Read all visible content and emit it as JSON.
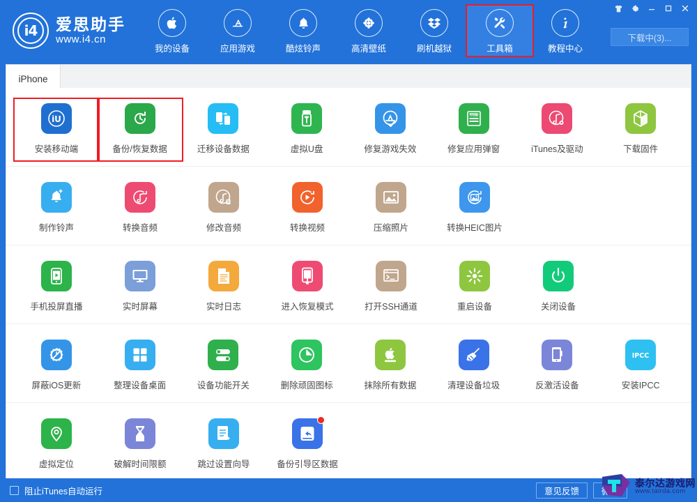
{
  "window": {
    "brand_name": "爱思助手",
    "brand_url": "www.i4.cn",
    "brand_logo_text": "i4",
    "controls": [
      {
        "name": "skin-icon",
        "label": "皮肤"
      },
      {
        "name": "settings-icon",
        "label": "设置"
      },
      {
        "name": "minimize-icon",
        "label": "最小化"
      },
      {
        "name": "maximize-icon",
        "label": "最大化"
      },
      {
        "name": "close-icon",
        "label": "关闭"
      }
    ],
    "download_button": "下载中(3)..."
  },
  "nav": {
    "items": [
      {
        "label": "我的设备",
        "icon": "apple-icon",
        "active": false,
        "highlighted": false
      },
      {
        "label": "应用游戏",
        "icon": "appstore-icon",
        "active": false,
        "highlighted": false
      },
      {
        "label": "酷炫铃声",
        "icon": "bell-icon",
        "active": false,
        "highlighted": false
      },
      {
        "label": "高清壁纸",
        "icon": "flower-icon",
        "active": false,
        "highlighted": false
      },
      {
        "label": "刷机越狱",
        "icon": "dropbox-icon",
        "active": false,
        "highlighted": false
      },
      {
        "label": "工具箱",
        "icon": "tools-icon",
        "active": true,
        "highlighted": true
      },
      {
        "label": "教程中心",
        "icon": "info-icon",
        "active": false,
        "highlighted": false
      }
    ]
  },
  "tabs": [
    {
      "label": "iPhone",
      "active": true
    }
  ],
  "toolbox": {
    "sections": [
      {
        "id": "section-1",
        "tiles": [
          {
            "label": "安装移动端",
            "icon": "i4-app-icon",
            "color": "#1f6fd0",
            "highlighted": false,
            "badge": false
          },
          {
            "label": "备份/恢复数据",
            "icon": "backup-restore-icon",
            "color": "#2ba84a",
            "highlighted": true,
            "badge": false
          },
          {
            "label": "迁移设备数据",
            "icon": "device-migrate-icon",
            "color": "#26bdf5",
            "highlighted": false,
            "badge": false
          },
          {
            "label": "虚拟U盘",
            "icon": "usb-drive-icon",
            "color": "#2fb550",
            "highlighted": false,
            "badge": false
          },
          {
            "label": "修复游戏失效",
            "icon": "appstore-fix-icon",
            "color": "#3494e8",
            "highlighted": false,
            "badge": false
          },
          {
            "label": "修复应用弹窗",
            "icon": "appleid-card-icon",
            "color": "#2fb04d",
            "highlighted": false,
            "badge": false
          },
          {
            "label": "iTunes及驱动",
            "icon": "itunes-driver-icon",
            "color": "#ec4a72",
            "highlighted": false,
            "badge": false
          },
          {
            "label": "下载固件",
            "icon": "firmware-cube-icon",
            "color": "#8ec640",
            "highlighted": false,
            "badge": false
          }
        ]
      },
      {
        "id": "section-2",
        "tiles": [
          {
            "label": "制作铃声",
            "icon": "ringtone-make-icon",
            "color": "#37aef0",
            "highlighted": false,
            "badge": false
          },
          {
            "label": "转换音频",
            "icon": "audio-convert-icon",
            "color": "#ee4b73",
            "highlighted": false,
            "badge": false
          },
          {
            "label": "修改音频",
            "icon": "audio-edit-icon",
            "color": "#c0a68d",
            "highlighted": false,
            "badge": false
          },
          {
            "label": "转换视频",
            "icon": "video-convert-icon",
            "color": "#f2622c",
            "highlighted": false,
            "badge": false
          },
          {
            "label": "压缩照片",
            "icon": "photo-compress-icon",
            "color": "#c0a68d",
            "highlighted": false,
            "badge": false
          },
          {
            "label": "转换HEIC图片",
            "icon": "heic-convert-icon",
            "color": "#3e96ed",
            "highlighted": false,
            "badge": false
          }
        ]
      },
      {
        "id": "section-3",
        "tiles": [
          {
            "label": "手机投屏直播",
            "icon": "screen-cast-icon",
            "color": "#2cb34a",
            "highlighted": false,
            "badge": false
          },
          {
            "label": "实时屏幕",
            "icon": "realtime-screen-icon",
            "color": "#7b9fd8",
            "highlighted": false,
            "badge": false
          },
          {
            "label": "实时日志",
            "icon": "realtime-log-icon",
            "color": "#f4a93c",
            "highlighted": false,
            "badge": false
          },
          {
            "label": "进入恢复模式",
            "icon": "recovery-mode-icon",
            "color": "#ee4b73",
            "highlighted": false,
            "badge": false
          },
          {
            "label": "打开SSH通道",
            "icon": "ssh-terminal-icon",
            "color": "#c0a68d",
            "highlighted": false,
            "badge": false
          },
          {
            "label": "重启设备",
            "icon": "restart-device-icon",
            "color": "#8ec640",
            "highlighted": false,
            "badge": false
          },
          {
            "label": "关闭设备",
            "icon": "power-off-icon",
            "color": "#12cb7a",
            "highlighted": false,
            "badge": false
          }
        ]
      },
      {
        "id": "section-4",
        "tiles": [
          {
            "label": "屏蔽iOS更新",
            "icon": "block-ios-update-icon",
            "color": "#3494e8",
            "highlighted": false,
            "badge": false
          },
          {
            "label": "整理设备桌面",
            "icon": "organize-desktop-icon",
            "color": "#37aef0",
            "highlighted": false,
            "badge": false
          },
          {
            "label": "设备功能开关",
            "icon": "feature-toggle-icon",
            "color": "#2fb04d",
            "highlighted": false,
            "badge": false
          },
          {
            "label": "删除顽固图标",
            "icon": "delete-icon-icon",
            "color": "#2ec45f",
            "highlighted": false,
            "badge": false
          },
          {
            "label": "抹除所有数据",
            "icon": "erase-all-icon",
            "color": "#8ec640",
            "highlighted": false,
            "badge": false
          },
          {
            "label": "清理设备垃圾",
            "icon": "clean-junk-icon",
            "color": "#3a72e8",
            "highlighted": false,
            "badge": false
          },
          {
            "label": "反激活设备",
            "icon": "deactivate-device-icon",
            "color": "#7b86d8",
            "highlighted": false,
            "badge": false
          },
          {
            "label": "安装IPCC",
            "icon": "ipcc-install-icon",
            "color": "#2ec0f0",
            "highlighted": false,
            "badge": false
          }
        ]
      },
      {
        "id": "section-5",
        "tiles": [
          {
            "label": "虚拟定位",
            "icon": "virtual-location-icon",
            "color": "#2cb34a",
            "highlighted": false,
            "badge": false
          },
          {
            "label": "破解时间限额",
            "icon": "time-limit-icon",
            "color": "#7b86d8",
            "highlighted": false,
            "badge": false
          },
          {
            "label": "跳过设置向导",
            "icon": "skip-setup-icon",
            "color": "#37aef0",
            "highlighted": false,
            "badge": false
          },
          {
            "label": "备份引导区数据",
            "icon": "backup-boot-icon",
            "color": "#3a72e8",
            "highlighted": false,
            "badge": true
          }
        ]
      }
    ]
  },
  "footer": {
    "checkbox_label": "阻止iTunes自动运行",
    "checkbox_checked": false,
    "buttons": [
      {
        "label": "意见反馈"
      },
      {
        "label": "微信"
      }
    ]
  },
  "watermark": {
    "title": "泰尔达游戏网",
    "url": "www.tairda.com"
  },
  "colors": {
    "header_blue": "#2272d9",
    "highlight_red": "#ee1c25",
    "content_white": "#ffffff",
    "label_gray": "#4a4a4a"
  }
}
